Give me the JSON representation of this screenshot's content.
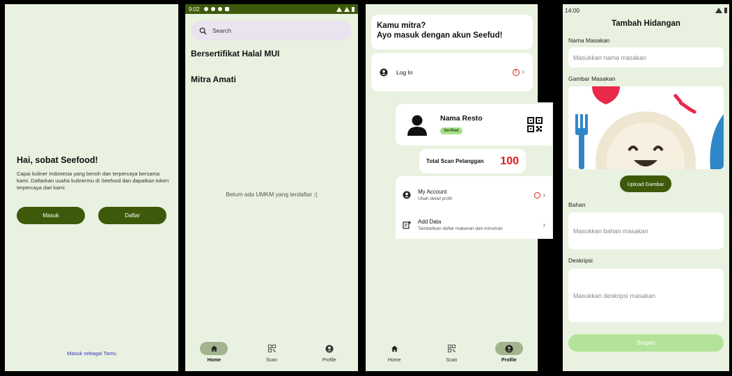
{
  "colors": {
    "primary": "#3d5a0b",
    "background": "#e9f2e0",
    "accent_red": "#e01b1b",
    "verified_green": "#a8e08a"
  },
  "welcome": {
    "title": "Hai, sobat Seefood!",
    "description": "Capai kuliner Indonesia yang bersih dan terpercaya bersama kami. Daftarkan usaha kulinermu di Seefood dan dapatkan token terpercaya dari kami",
    "login_label": "Masuk",
    "register_label": "Daftar",
    "guest_link": "Masuk sebagai Tamu"
  },
  "home": {
    "status_time": "9:02",
    "search_placeholder": "Search",
    "items": [
      "Bersertifikat Halal MUI",
      "Mitra Amati"
    ],
    "empty_message": "Belum ada UMKM yang terdaftar :("
  },
  "nav": {
    "home": "Home",
    "scan": "Scan",
    "profile": "Profile"
  },
  "profile": {
    "hero_line1": "Kamu mitra?",
    "hero_line2": "Ayo masuk dengan akun Seefud!",
    "login_label": "Log In",
    "resto_name": "Nama Resto",
    "verified_label": "Verified",
    "scan_label": "Total Scan Pelanggan",
    "scan_count": "100",
    "account_title": "My Account",
    "account_sub": "Ubah detail profil",
    "adddata_title": "Add Data",
    "adddata_sub": "Tambahkan daftar makanan dan minuman"
  },
  "add_dish": {
    "status_time": "14:00",
    "title": "Tambah Hidangan",
    "name_label": "Nama Masakan",
    "name_placeholder": "Masukkan nama masakan",
    "image_label": "Gambar Masakan",
    "upload_label": "Upload Gambar",
    "ingredients_label": "Bahan",
    "ingredients_placeholder": "Masukkan bahan masakan",
    "description_label": "Deskripsi",
    "description_placeholder": "Masukkan deskripsi masakan",
    "save_label": "Simpan"
  }
}
